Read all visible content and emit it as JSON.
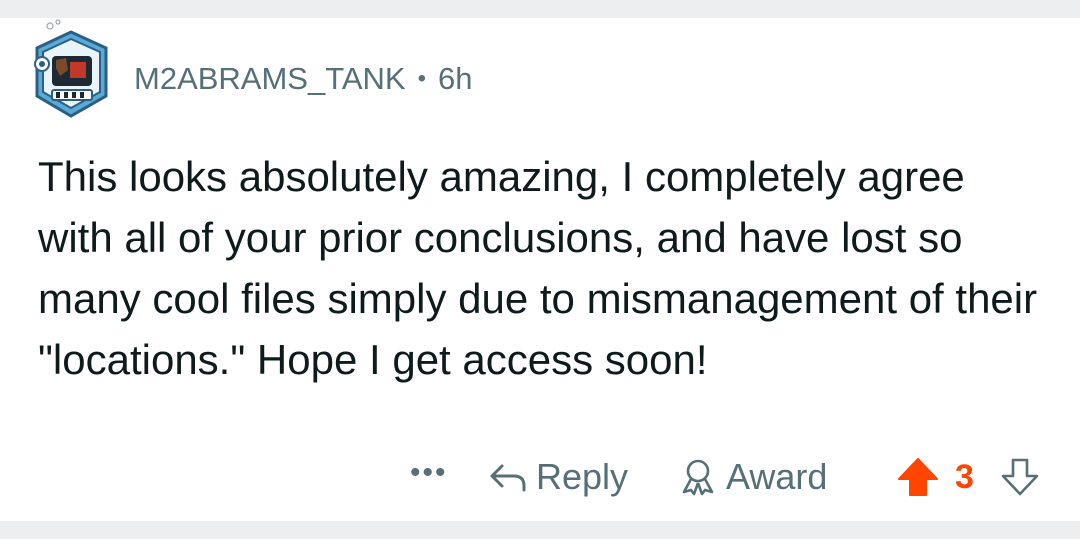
{
  "comment": {
    "username": "M2ABRAMS_TANK",
    "separator": "•",
    "age": "6h",
    "text": "This looks absolutely amazing, I completely agree with all of your prior conclusions, and have lost so many cool files simply due to mismanagement of their \"locations.\" Hope I get access soon!"
  },
  "actions": {
    "more_label": "•••",
    "reply_label": "Reply",
    "award_label": "Award",
    "score": "3"
  },
  "colors": {
    "accent_upvote": "#ff4500",
    "meta_text": "#576f76",
    "body_text": "#0f1a1c"
  },
  "icons": {
    "avatar": "robot-avatar",
    "reply": "reply-arrow-icon",
    "award": "award-ribbon-icon",
    "upvote": "upvote-arrow-icon",
    "downvote": "downvote-arrow-icon"
  }
}
